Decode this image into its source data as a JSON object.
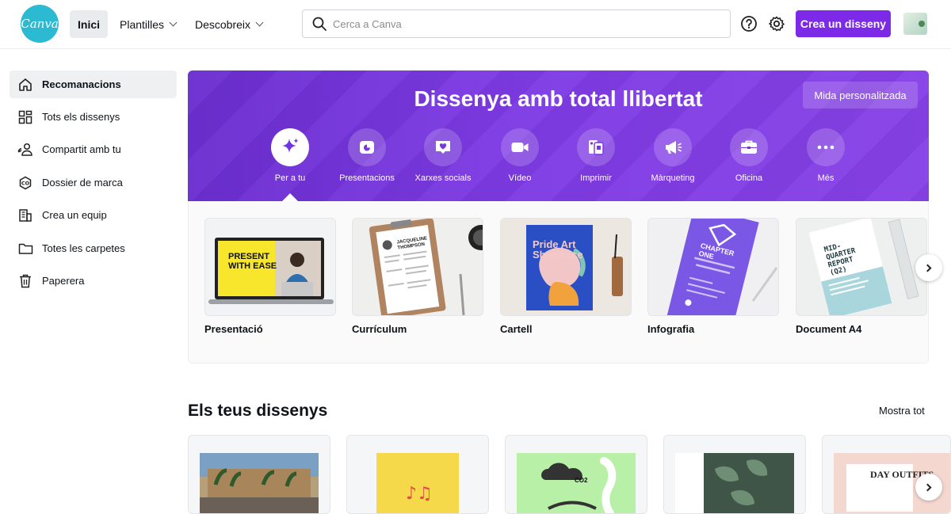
{
  "header": {
    "logo_text": "Canva",
    "nav": [
      {
        "label": "Inici",
        "active": true
      },
      {
        "label": "Plantilles",
        "dropdown": true
      },
      {
        "label": "Descobreix",
        "dropdown": true
      }
    ],
    "search_placeholder": "Cerca a Canva",
    "create_label": "Crea un disseny"
  },
  "sidebar": {
    "items": [
      {
        "label": "Recomanacions",
        "icon": "home-icon",
        "active": true
      },
      {
        "label": "Tots els dissenys",
        "icon": "grid-icon"
      },
      {
        "label": "Compartit amb tu",
        "icon": "shared-users-icon"
      },
      {
        "label": "Dossier de marca",
        "icon": "brand-kit-icon"
      },
      {
        "label": "Crea un equip",
        "icon": "team-building-icon"
      },
      {
        "label": "Totes les carpetes",
        "icon": "folder-icon"
      },
      {
        "label": "Paperera",
        "icon": "trash-icon"
      }
    ]
  },
  "hero": {
    "title": "Dissenya amb total llibertat",
    "custom_size_label": "Mida personalitzada",
    "categories": [
      {
        "label": "Per a tu",
        "icon": "sparkle-icon",
        "active": true
      },
      {
        "label": "Presentacions",
        "icon": "presentation-icon"
      },
      {
        "label": "Xarxes socials",
        "icon": "social-heart-icon"
      },
      {
        "label": "Vídeo",
        "icon": "video-camera-icon"
      },
      {
        "label": "Imprimir",
        "icon": "print-icon"
      },
      {
        "label": "Màrqueting",
        "icon": "megaphone-icon"
      },
      {
        "label": "Oficina",
        "icon": "briefcase-icon"
      },
      {
        "label": "Més",
        "icon": "more-dots-icon"
      }
    ]
  },
  "templates": {
    "items": [
      {
        "label": "Presentació",
        "thumb_text": "PRESENT WITH EASE"
      },
      {
        "label": "Currículum",
        "thumb_text": "JACQUELINE THOMPSON"
      },
      {
        "label": "Cartell",
        "thumb_text": "Pride Art Showcase"
      },
      {
        "label": "Infografia",
        "thumb_text": "CHAPTER ONE"
      },
      {
        "label": "Document A4",
        "thumb_text": "MID-QUARTER REPORT (Q2)"
      }
    ]
  },
  "designs": {
    "title": "Els teus dissenys",
    "show_all": "Mostra tot",
    "items": [
      {
        "name": "design-plaza"
      },
      {
        "name": "design-yellow-music"
      },
      {
        "name": "design-co2-map",
        "thumb_text": "CO2"
      },
      {
        "name": "design-leaves"
      },
      {
        "name": "design-day-outfits",
        "thumb_text": "DAY OUTFITS"
      }
    ]
  },
  "colors": {
    "brand_purple": "#7d2ae8",
    "logo_teal": "#2bbad1"
  }
}
